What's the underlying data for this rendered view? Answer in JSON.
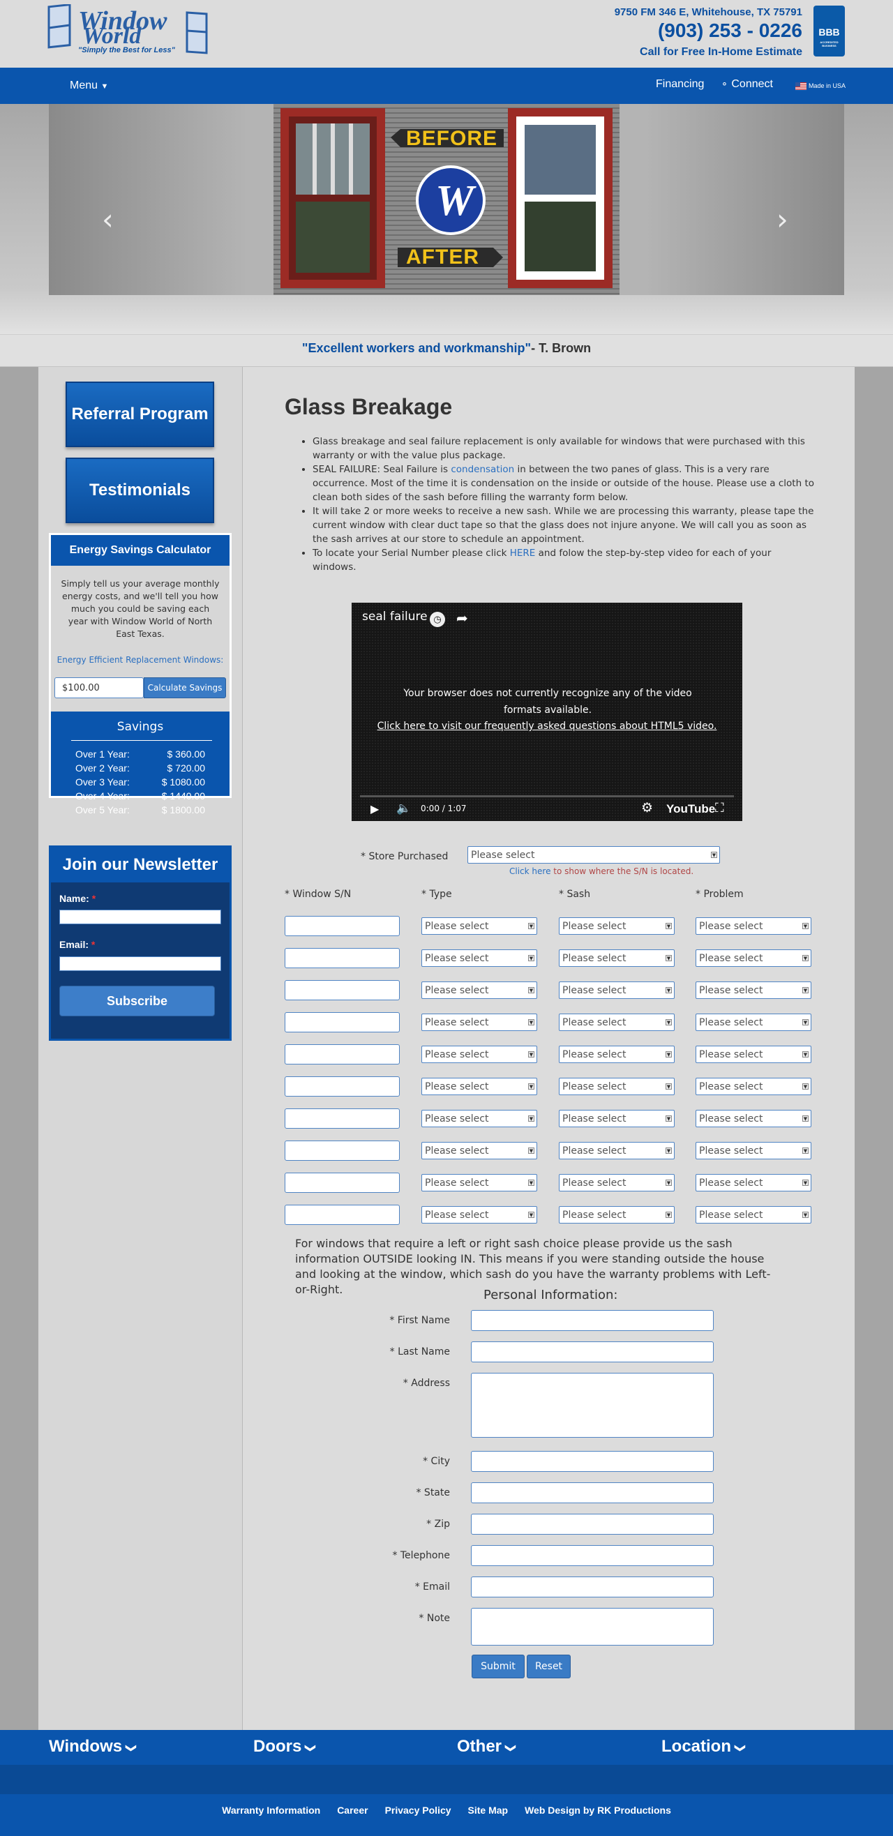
{
  "header": {
    "logo_word1": "Window",
    "logo_word2": "World",
    "tagline": "\"Simply the Best for Less\"",
    "address": "9750 FM 346 E, Whitehouse, TX 75791",
    "phone": "(903) 253 - 0226",
    "cta": "Call for Free In-Home Estimate",
    "bbb": "BBB",
    "bbb_sub": "ACCREDITED BUSINESS"
  },
  "nav": {
    "menu": "Menu",
    "financing": "Financing",
    "connect": "Connect",
    "made_in_usa": "Made in USA"
  },
  "hero": {
    "before": "BEFORE",
    "after": "AFTER",
    "badge": "W",
    "prev": "‹",
    "next": "›"
  },
  "quote": {
    "text": "\"Excellent workers and workmanship\"",
    "author": "- T. Brown"
  },
  "sidebar": {
    "referral": "Referral Program",
    "testimonials": "Testimonials",
    "calc_title": "Energy Savings Calculator",
    "calc_desc": "Simply tell us your average monthly energy costs, and we'll tell you how much you could be saving each year with Window World of North East Texas.",
    "calc_link": "Energy Efficient Replacement Windows:",
    "calc_value": "$100.00",
    "calc_button": "Calculate Savings",
    "savings_title": "Savings",
    "savings": [
      {
        "label": "Over 1 Year:",
        "value": "$ 360.00"
      },
      {
        "label": "Over 2 Year:",
        "value": "$ 720.00"
      },
      {
        "label": "Over 3 Year:",
        "value": "$ 1080.00"
      },
      {
        "label": "Over 4 Year:",
        "value": "$ 1440.00"
      },
      {
        "label": "Over 5 Year:",
        "value": "$ 1800.00"
      }
    ],
    "newsletter_title": "Join our Newsletter",
    "name_label": "Name:",
    "email_label": "Email:",
    "required_mark": "*",
    "subscribe": "Subscribe"
  },
  "main": {
    "title": "Glass Breakage",
    "bullets": [
      {
        "pre": "Glass breakage and seal failure replacement is only available for windows that were purchased with this warranty or with the value plus package.",
        "link": "",
        "post": ""
      },
      {
        "pre": "SEAL FAILURE: Seal Failure is ",
        "link": "condensation",
        "post": " in between the two panes of glass. This is a very rare occurrence. Most of the time it is condensation on the inside or outside of the house. Please use a cloth to clean both sides of the sash before filling the warranty form below."
      },
      {
        "pre": "It will take 2 or more weeks to receive a new sash. While we are processing this warranty, please tape the current window with clear duct tape so that the glass does not injure anyone. We will call you as soon as the sash arrives at our store to schedule an appointment.",
        "link": "",
        "post": ""
      },
      {
        "pre": "To locate your Serial Number please click ",
        "link": "HERE",
        "post": " and folow the step-by-step video for each of your windows."
      }
    ],
    "video": {
      "title": "seal failure",
      "msg": "Your browser does not currently recognize any of the video formats available.",
      "link": "Click here to visit our frequently asked questions about HTML5 video.",
      "time": "0:00 / 1:07",
      "brand": "YouTube"
    },
    "store_label": "* Store Purchased",
    "select_placeholder": "Please select",
    "sn_hint_link": "Click here",
    "sn_hint_rest": " to show where the S/N is located.",
    "col_headers": [
      "* Window S/N",
      "* Type",
      "* Sash",
      "* Problem"
    ],
    "rows": 10,
    "sash_note": "For windows that require a left or right sash choice please provide us the sash information OUTSIDE looking IN. This means if you were standing outside the house and looking at the window, which sash do you have the warranty problems with Left-or-Right.",
    "personal_title": "Personal Information:",
    "fields": [
      "* First Name",
      "* Last Name",
      "* Address",
      "* City",
      "* State",
      "* Zip",
      "* Telephone",
      "* Email",
      "* Note"
    ],
    "submit": "Submit",
    "reset": "Reset"
  },
  "footer": {
    "nav": [
      "Windows",
      "Doors",
      "Other",
      "Location"
    ],
    "links": [
      "Warranty Information",
      "Career",
      "Privacy Policy",
      "Site Map",
      "Web Design by RK Productions"
    ]
  },
  "colors": {
    "brand_blue": "#0a55ad",
    "accent_yellow": "#f2c21a"
  }
}
